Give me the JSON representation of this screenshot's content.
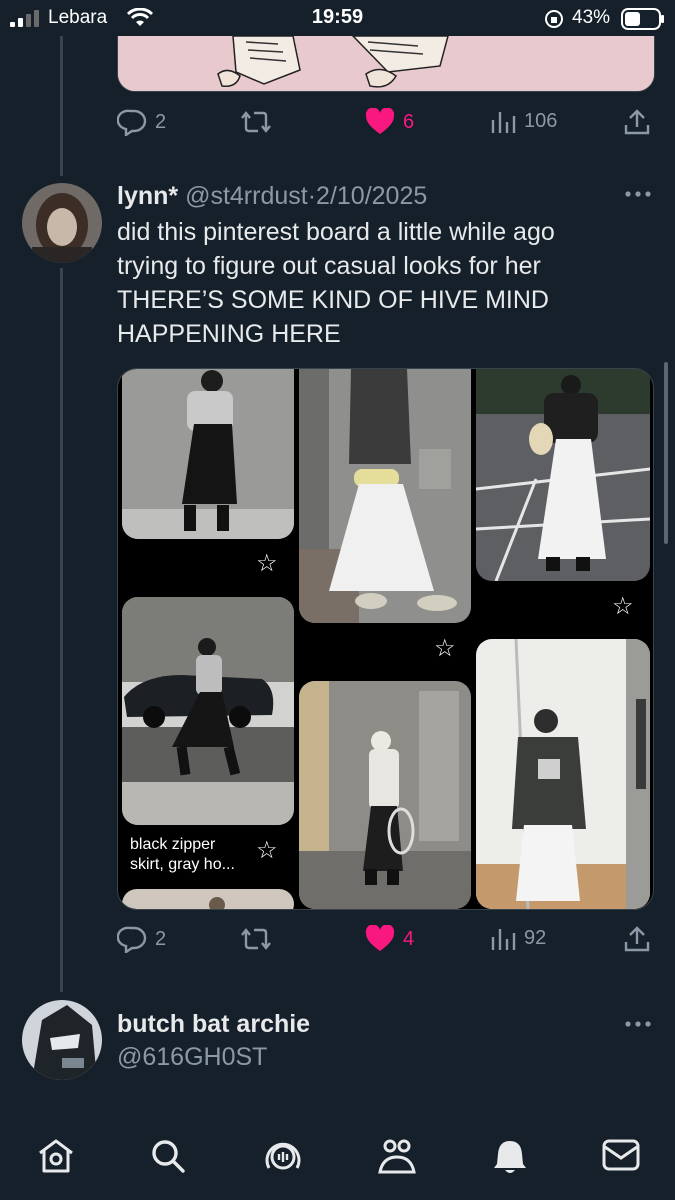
{
  "status_bar": {
    "carrier": "Lebara",
    "time": "19:59",
    "battery": "43%"
  },
  "prev_tweet": {
    "replies": "2",
    "likes": "6",
    "views": "106"
  },
  "tweet": {
    "display_name": "lynn*",
    "handle": "@st4rrdust",
    "separator": "·",
    "date": "2/10/2025",
    "text_lines": [
      "did this pinterest board a little while ago",
      "trying to figure out casual looks for her",
      "THERE’S SOME KIND OF HIVE MIND",
      "HAPPENING HERE"
    ],
    "pin_caption_1": "black zipper",
    "pin_caption_2": "skirt, gray ho...",
    "replies": "2",
    "likes": "4",
    "views": "92"
  },
  "next_tweet": {
    "display_name": "butch bat archie",
    "handle": "@616GH0ST"
  },
  "colors": {
    "background": "#15202b",
    "text": "#e7e9ea",
    "muted": "#8b98a5",
    "like": "#f91880"
  },
  "icons": [
    "signal-icon",
    "wifi-icon",
    "orientation-lock-icon",
    "battery-icon",
    "reply-icon",
    "retweet-icon",
    "heart-icon",
    "views-icon",
    "share-icon",
    "more-icon",
    "home-icon",
    "search-icon",
    "spaces-icon",
    "communities-icon",
    "notifications-icon",
    "messages-icon"
  ]
}
